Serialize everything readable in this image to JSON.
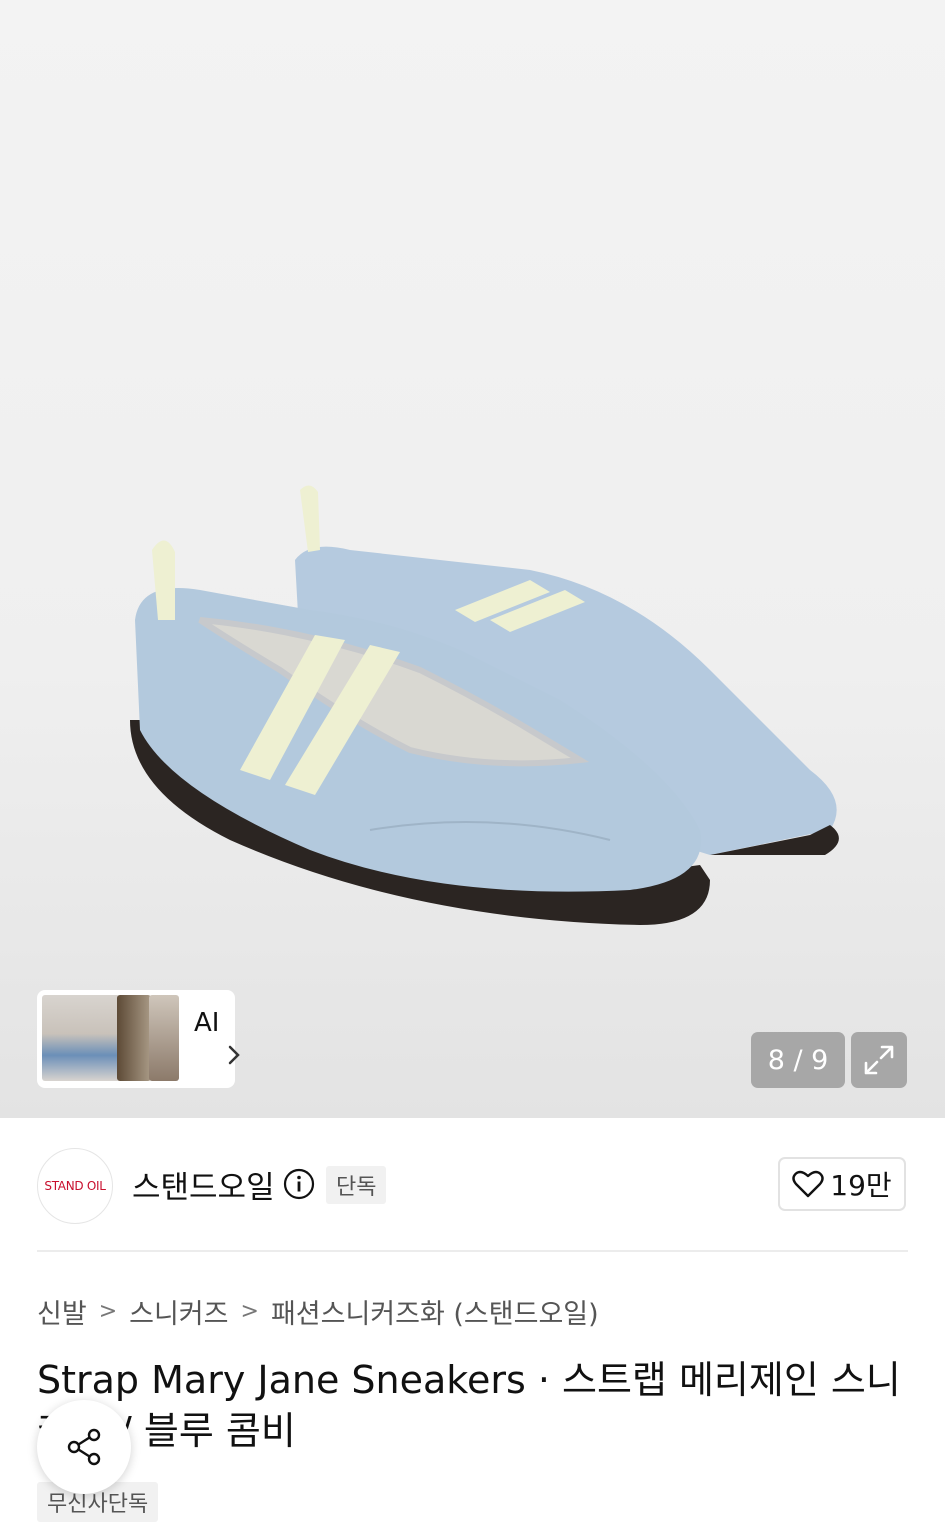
{
  "gallery": {
    "counter": "8 / 9",
    "ai_label": "AI"
  },
  "brand": {
    "logo_text": "STAND OIL",
    "name": "스탠드오일",
    "badge": "단독",
    "likes": "19만"
  },
  "breadcrumb": [
    "신발",
    "스니커즈",
    "패션스니커즈화 (스탠드오일)"
  ],
  "product": {
    "title": "Strap Mary Jane Sneakers · 스트랩 메리제인 스니커즈 / 블루 콤비",
    "tag": "무신사단독"
  },
  "colors": {
    "brand_red": "#c8102e",
    "shoe_blue": "#b3c9dd",
    "strap_cream": "#eef0d2"
  }
}
